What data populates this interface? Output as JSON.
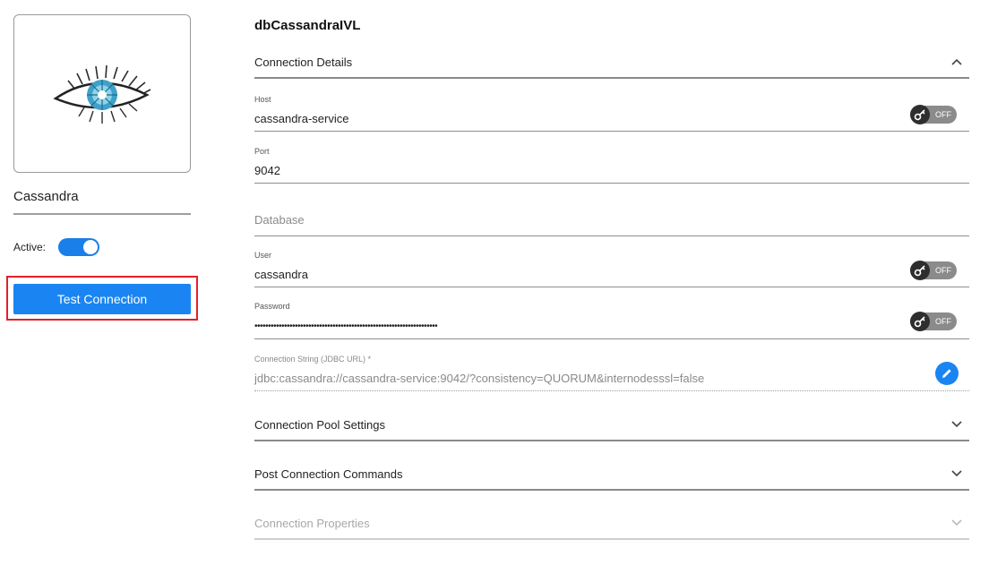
{
  "sidebar": {
    "db_name": "Cassandra",
    "active_label": "Active:",
    "active": true,
    "test_connection_label": "Test Connection"
  },
  "page": {
    "title": "dbCassandraIVL"
  },
  "sections": {
    "connection_details": "Connection Details",
    "connection_pool": "Connection Pool Settings",
    "post_connection": "Post Connection Commands",
    "connection_properties": "Connection Properties"
  },
  "fields": {
    "host": {
      "label": "Host",
      "value": "cassandra-service",
      "vault": "OFF"
    },
    "port": {
      "label": "Port",
      "value": "9042"
    },
    "database": {
      "placeholder": "Database"
    },
    "user": {
      "label": "User",
      "value": "cassandra",
      "vault": "OFF"
    },
    "password": {
      "label": "Password",
      "value": "••••••••••••••••••••••••••••••••••••••••••••••••••••••••••••••••••••",
      "vault": "OFF"
    },
    "jdbc": {
      "label": "Connection String (JDBC URL) *",
      "value": "jdbc:cassandra://cassandra-service:9042/?consistency=QUORUM&internodesssl=false"
    }
  },
  "colors": {
    "accent": "#1a85f2",
    "highlight_border": "#e0202a",
    "toggle_off": "#8b8b8b"
  },
  "icons": {
    "logo": "cassandra-eye-logo",
    "chevron_up": "chevron-up-icon",
    "chevron_down": "chevron-down-icon",
    "key": "key-icon",
    "edit": "pencil-icon"
  }
}
